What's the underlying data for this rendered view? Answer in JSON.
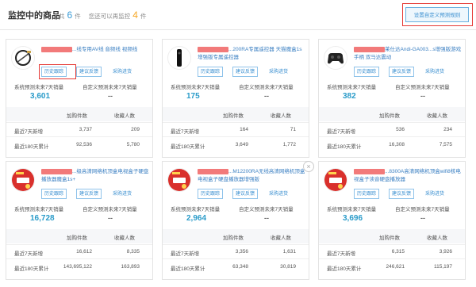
{
  "header": {
    "title": "监控中的商品",
    "count_prefix": "共",
    "count": "6",
    "count_unit": "件",
    "remain_text": "您还可以再监控",
    "remain": "4",
    "remain_unit": "件",
    "settings_button": "设置自定义预测规则"
  },
  "card_labels": {
    "history": "历史跟踪",
    "feedback": "建议反馈",
    "purchase": "采购进货",
    "sys_pred": "系统预测未来7天销量",
    "custom_pred": "自定义预测未来7天销量",
    "col_cart": "加购件数",
    "col_fav": "收藏人数",
    "row_7d": "最近7天新增",
    "row_180d": "最近180天累计",
    "dash": "--"
  },
  "products": [
    {
      "name_visible": "...线专用AV线 音频线 视频线",
      "sys_pred": "3,601",
      "cart_7d": "3,737",
      "fav_7d": "209",
      "cart_180d": "92,536",
      "fav_180d": "5,780",
      "thumb": "cable-image"
    },
    {
      "name_visible": "...200RA专属遥控器 天猫魔盒1s增强版专属遥控器",
      "sys_pred": "175",
      "cart_7d": "164",
      "fav_7d": "71",
      "cart_180d": "3,649",
      "fav_180d": "1,772",
      "thumb": "remote-image"
    },
    {
      "name_visible": "莱仕达Andi-GA003...s增强版游戏手柄 双马达震动",
      "sys_pred": "382",
      "cart_7d": "536",
      "fav_7d": "234",
      "cart_180d": "16,308",
      "fav_180d": "7,575",
      "thumb": "gamepad-image"
    },
    {
      "name_visible": "...级高清网络机顶盒电视盒子硬盘播放器魔盒1s+",
      "sys_pred": "16,728",
      "cart_7d": "16,612",
      "fav_7d": "8,335",
      "cart_180d": "143,695,122",
      "fav_180d": "163,893",
      "thumb": "tvbox-image"
    },
    {
      "name_visible": "...M12200RA无线高清网络机顶盒电视盒子硬盘播放器增强版",
      "sys_pred": "2,964",
      "cart_7d": "3,356",
      "fav_7d": "1,631",
      "cart_180d": "63,348",
      "fav_180d": "30,819",
      "thumb": "tvbox-image"
    },
    {
      "name_visible": "...8300A高清网络机顶盒wifi8核电视盒子读音硬盘播放器",
      "sys_pred": "3,696",
      "cart_7d": "6,315",
      "fav_7d": "3,926",
      "cart_180d": "246,621",
      "fav_180d": "115,197",
      "thumb": "tvbox-image"
    }
  ],
  "colors": {
    "accent": "#3a9bd6",
    "highlight": "#e53935",
    "count_orange": "#f5a623"
  }
}
